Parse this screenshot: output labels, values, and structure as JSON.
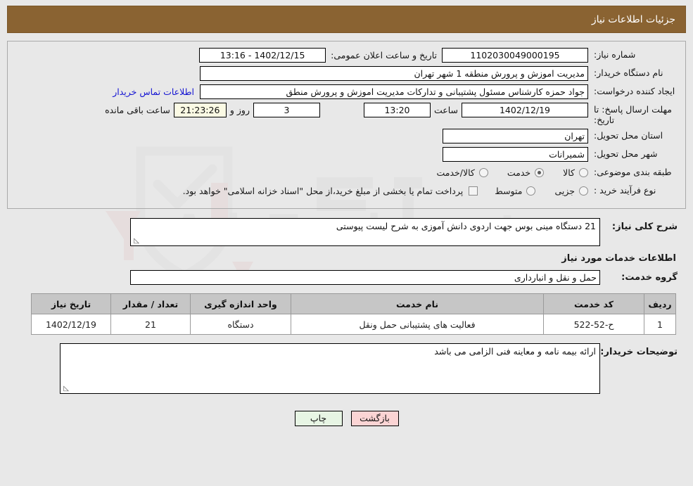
{
  "header": {
    "title": "جزئیات اطلاعات نیاز",
    "bg_color": "#8a6332",
    "text_color": "#ffffff"
  },
  "info": {
    "need_number_label": "شماره نیاز:",
    "need_number_value": "1102030049000195",
    "announce_label": "تاریخ و ساعت اعلان عمومی:",
    "announce_value": "1402/12/15 - 13:16",
    "buyer_org_label": "نام دستگاه خریدار:",
    "buyer_org_value": "مدیریت اموزش و پرورش منطقه 1 شهر تهران",
    "creator_label": "ایجاد کننده درخواست:",
    "creator_value": "جواد حمزه کارشناس مسئول پشتیبانی و تدارکات مدیریت اموزش و پرورش منطق",
    "contact_link": "اطلاعات تماس خریدار",
    "deadline_label": "مهلت ارسال پاسخ: تا تاریخ:",
    "deadline_date": "1402/12/19",
    "hour_label": "ساعت",
    "deadline_time": "13:20",
    "days_value": "3",
    "days_label": "روز و",
    "countdown_value": "21:23:26",
    "remaining_label": "ساعت باقی مانده",
    "province_label": "استان محل تحویل:",
    "province_value": "تهران",
    "city_label": "شهر محل تحویل:",
    "city_value": "شمیرانات",
    "category_label": "طبقه بندی موضوعی:",
    "category_options": [
      {
        "label": "کالا",
        "selected": false
      },
      {
        "label": "خدمت",
        "selected": true
      },
      {
        "label": "کالا/خدمت",
        "selected": false
      }
    ],
    "process_label": "نوع فرآیند خرید :",
    "process_options": [
      {
        "label": "جزیی",
        "selected": false
      },
      {
        "label": "متوسط",
        "selected": false
      }
    ],
    "treasury_checkbox_label": "پرداخت تمام یا بخشی از مبلغ خرید،از محل \"اسناد خزانه اسلامی\" خواهد بود.",
    "treasury_checked": false
  },
  "need": {
    "summary_label": "شرح کلی نیاز:",
    "summary_value": "21 دستگاه مینی بوس جهت اردوی دانش آموزی به شرح لیست پیوستی"
  },
  "services": {
    "section_title": "اطلاعات خدمات مورد نیاز",
    "group_label": "گروه خدمت:",
    "group_value": "حمل و نقل و انبارداری",
    "columns": [
      "ردیف",
      "کد خدمت",
      "نام خدمت",
      "واحد اندازه گیری",
      "تعداد / مقدار",
      "تاریخ نیاز"
    ],
    "rows": [
      {
        "index": "1",
        "code": "ح-52-522",
        "name": "فعالیت های پشتیبانی حمل ونقل",
        "unit": "دستگاه",
        "quantity": "21",
        "date": "1402/12/19"
      }
    ]
  },
  "buyer_notes": {
    "label": "توضیحات خریدار:",
    "value": "ارائه بیمه نامه و معاینه فنی الزامی می باشد"
  },
  "footer": {
    "print_label": "چاپ",
    "back_label": "بازگشت",
    "print_color": "#e7f5e4",
    "back_color": "#fbd4d4"
  },
  "watermark": {
    "text": "AriaTender.net"
  }
}
